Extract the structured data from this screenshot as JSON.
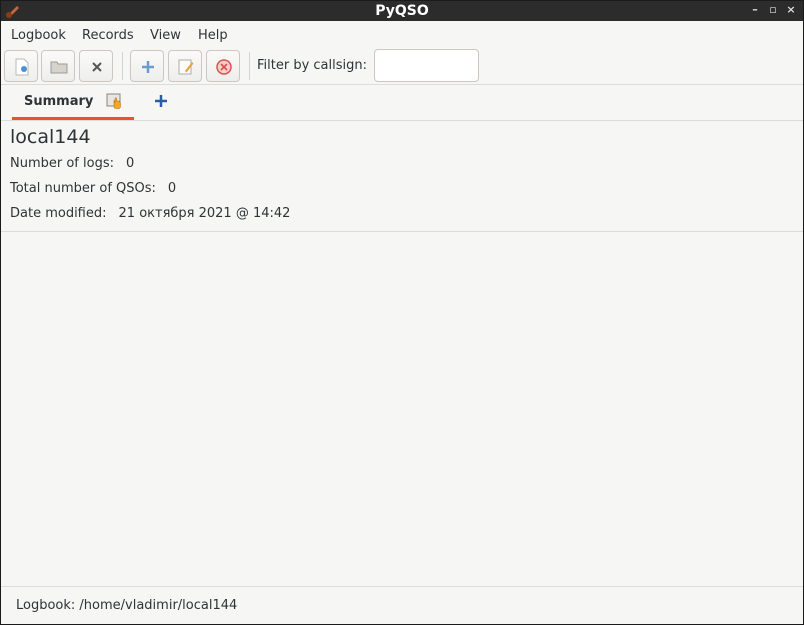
{
  "window": {
    "title": "PyQSO",
    "wm_buttons": [
      "–",
      "▫",
      "×"
    ]
  },
  "menubar": {
    "items": [
      "Logbook",
      "Records",
      "View",
      "Help"
    ]
  },
  "toolbar": {
    "icons": [
      "new-logbook-icon",
      "open-logbook-icon",
      "close-logbook-icon",
      "add-record-icon",
      "edit-record-icon",
      "delete-record-icon"
    ],
    "filter_label": "Filter by callsign:",
    "filter_value": ""
  },
  "tabs": {
    "summary_label": "Summary"
  },
  "summary": {
    "name": "local144",
    "logs_label": "Number of logs:",
    "logs_value": "0",
    "qsos_label": "Total number of QSOs:",
    "qsos_value": "0",
    "modified_label": "Date modified:",
    "modified_value": "21 октября 2021 @ 14:42"
  },
  "statusbar": {
    "text": "Logbook: /home/vladimir/local144"
  },
  "colors": {
    "accent": "#e95420",
    "titlebar": "#2c2c2c",
    "background": "#f6f6f5"
  }
}
